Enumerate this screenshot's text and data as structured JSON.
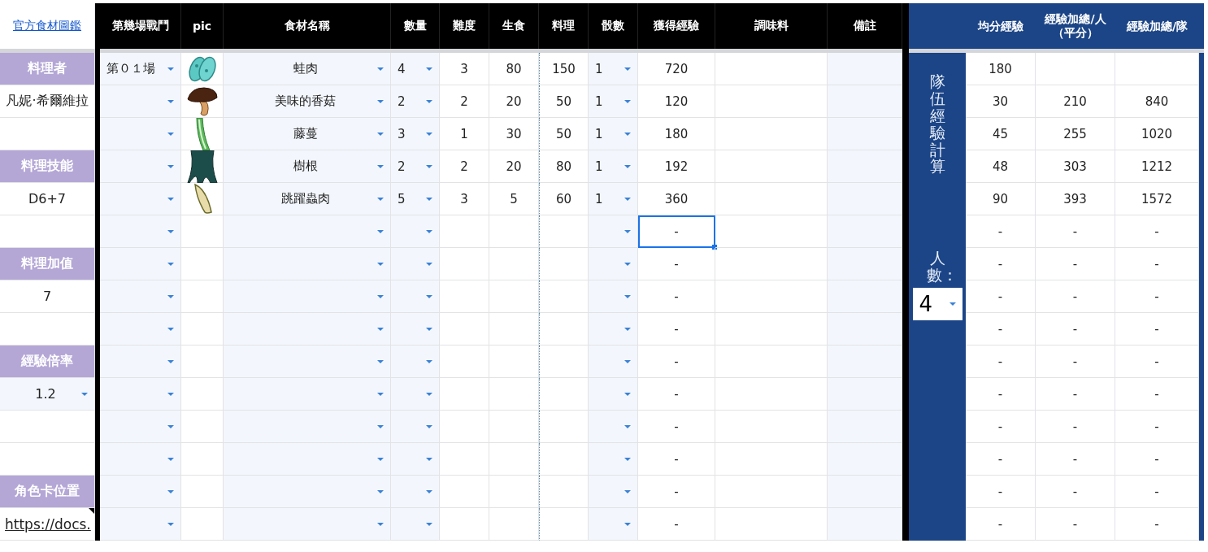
{
  "link": "官方食材圖鑑",
  "left": [
    {
      "kind": "label",
      "text": "料理者"
    },
    {
      "kind": "value",
      "text": "凡妮·希爾維拉"
    },
    {
      "kind": "empty"
    },
    {
      "kind": "label",
      "text": "料理技能"
    },
    {
      "kind": "value",
      "text": "D6+7"
    },
    {
      "kind": "empty"
    },
    {
      "kind": "label",
      "text": "料理加值"
    },
    {
      "kind": "value",
      "text": "7"
    },
    {
      "kind": "empty"
    },
    {
      "kind": "label",
      "text": "經驗倍率"
    },
    {
      "kind": "dropdown",
      "text": "1.2"
    },
    {
      "kind": "empty"
    },
    {
      "kind": "empty"
    },
    {
      "kind": "label",
      "text": "角色卡位置"
    },
    {
      "kind": "link",
      "text": "https://docs.",
      "note": true
    }
  ],
  "columns": [
    "第幾場戰鬥",
    "pic",
    "食材名稱",
    "數量",
    "難度",
    "生食",
    "料理",
    "骰數",
    "獲得經驗",
    "調味料",
    "備註"
  ],
  "rows": [
    {
      "battle": "第０１場",
      "kind": "meat",
      "name": "蛙肉",
      "qty": "4",
      "difficulty": "3",
      "raw": "80",
      "cooked": "150",
      "dice": "1",
      "exp": "720",
      "selected": false
    },
    {
      "kind": "mushroom",
      "name": "美味的香菇",
      "qty": "2",
      "difficulty": "2",
      "raw": "20",
      "cooked": "50",
      "dice": "1",
      "exp": "120",
      "selected": false
    },
    {
      "kind": "vine",
      "name": "藤蔓",
      "qty": "3",
      "difficulty": "1",
      "raw": "30",
      "cooked": "50",
      "dice": "1",
      "exp": "180",
      "selected": false
    },
    {
      "kind": "root",
      "name": "樹根",
      "qty": "2",
      "difficulty": "2",
      "raw": "20",
      "cooked": "80",
      "dice": "1",
      "exp": "192",
      "selected": false
    },
    {
      "kind": "larva",
      "name": "跳躍蟲肉",
      "qty": "5",
      "difficulty": "3",
      "raw": "5",
      "cooked": "60",
      "dice": "1",
      "exp": "360",
      "selected": false
    },
    {
      "exp": "-",
      "selected": true
    },
    {
      "exp": "-",
      "selected": false
    },
    {
      "exp": "-",
      "selected": false
    },
    {
      "exp": "-",
      "selected": false
    },
    {
      "exp": "-",
      "selected": false
    },
    {
      "exp": "-",
      "selected": false
    },
    {
      "exp": "-",
      "selected": false
    },
    {
      "exp": "-",
      "selected": false
    },
    {
      "exp": "-",
      "selected": false
    },
    {
      "exp": "-",
      "selected": false
    }
  ],
  "summary": {
    "title": "隊伍經驗計算",
    "count_label": "人數：",
    "count": "4",
    "columns": [
      "均分經驗",
      "經驗加總/人（平分）",
      "經驗加總/隊"
    ],
    "rows": [
      {
        "avg": "180"
      },
      {
        "avg": "30",
        "per_person": "210",
        "per_team": "840"
      },
      {
        "avg": "45",
        "per_person": "255",
        "per_team": "1020"
      },
      {
        "avg": "48",
        "per_person": "303",
        "per_team": "1212"
      },
      {
        "avg": "90",
        "per_person": "393",
        "per_team": "1572"
      },
      {
        "avg": "-",
        "per_person": "-",
        "per_team": "-"
      },
      {
        "avg": "-",
        "per_person": "-",
        "per_team": "-"
      },
      {
        "avg": "-",
        "per_person": "-",
        "per_team": "-"
      },
      {
        "avg": "-",
        "per_person": "-",
        "per_team": "-"
      },
      {
        "avg": "-",
        "per_person": "-",
        "per_team": "-"
      },
      {
        "avg": "-",
        "per_person": "-",
        "per_team": "-"
      },
      {
        "avg": "-",
        "per_person": "-",
        "per_team": "-"
      },
      {
        "avg": "-",
        "per_person": "-",
        "per_team": "-"
      },
      {
        "avg": "-",
        "per_person": "-",
        "per_team": "-"
      },
      {
        "avg": "-",
        "per_person": "-",
        "per_team": "-"
      }
    ]
  }
}
